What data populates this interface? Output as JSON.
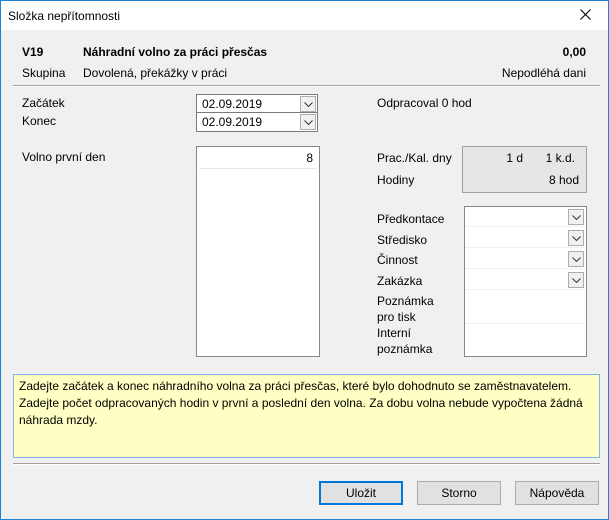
{
  "window": {
    "title": "Složka nepřítomnosti"
  },
  "header": {
    "code": "V19",
    "name": "Náhradní volno za práci přesčas",
    "amount": "0,00",
    "group_label": "Skupina",
    "group_value": "Dovolená, překážky v práci",
    "tax_status": "Nepodléhá dani"
  },
  "dates": {
    "start_label": "Začátek",
    "start_value": "02.09.2019",
    "end_label": "Konec",
    "end_value": "02.09.2019",
    "worked_text": "Odpracoval 0 hod"
  },
  "first_day": {
    "label": "Volno první den",
    "value": "8"
  },
  "summary": {
    "workcal_label": "Prac./Kal. dny",
    "days_work": "1 d",
    "days_cal": "1 k.d.",
    "hours_label": "Hodiny",
    "hours_value": "8 hod"
  },
  "props": {
    "predkontace": "Předkontace",
    "stredisko": "Středisko",
    "cinnost": "Činnost",
    "zakazka": "Zakázka",
    "note_print_1": "Poznámka",
    "note_print_2": "pro tisk",
    "note_internal_1": "Interní",
    "note_internal_2": "poznámka"
  },
  "hint": {
    "line1": "Zadejte začátek a konec náhradního volna za práci přesčas, které bylo dohodnuto se zaměstnavatelem.",
    "line2": "Zadejte počet odpracovaných hodin v první a poslední den volna. Za dobu volna nebude vypočtena žádná",
    "line3": "náhrada mzdy."
  },
  "buttons": {
    "save": "Uložit",
    "cancel": "Storno",
    "help": "Nápověda"
  },
  "icons": {
    "close": "close-icon",
    "dropdown": "chevron-down-icon"
  }
}
